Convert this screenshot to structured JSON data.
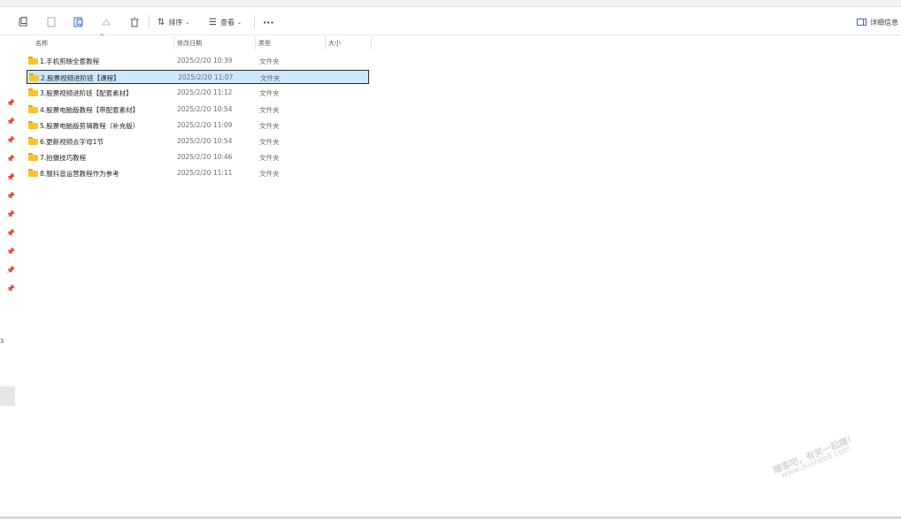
{
  "toolbar": {
    "sort_label": "排序",
    "view_label": "查看",
    "more_label": "···",
    "details_label": "详细信息"
  },
  "columns": {
    "name": "名称",
    "modified": "修改日期",
    "type": "类型",
    "size": "大小"
  },
  "files": [
    {
      "name": "1.手机剪映全套教程",
      "modified": "2025/2/20 10:39",
      "type": "文件夹",
      "size": ""
    },
    {
      "name": "2.股票视频进阶班【课程】",
      "modified": "2025/2/20 11:07",
      "type": "文件夹",
      "size": ""
    },
    {
      "name": "3.股票视频进阶班【配套素材】",
      "modified": "2025/2/20 11:12",
      "type": "文件夹",
      "size": ""
    },
    {
      "name": "4.股票电脑版教程【带配套素材】",
      "modified": "2025/2/20 10:54",
      "type": "文件夹",
      "size": ""
    },
    {
      "name": "5.股票电脑版剪辑教程（补充版）",
      "modified": "2025/2/20 11:09",
      "type": "文件夹",
      "size": ""
    },
    {
      "name": "6.更新视频去字母1节",
      "modified": "2025/2/20 10:54",
      "type": "文件夹",
      "size": ""
    },
    {
      "name": "7.拍摄技巧教程",
      "modified": "2025/2/20 10:46",
      "type": "文件夹",
      "size": ""
    },
    {
      "name": "8.服抖音运营教程作为参考",
      "modified": "2025/2/20 11:11",
      "type": "文件夹",
      "size": ""
    }
  ],
  "selected_index": 1,
  "watermark": {
    "line1": "赚客吧，有奖一起赚！",
    "line2": "www.zuanke8.com"
  },
  "sidebar_mark": "3"
}
